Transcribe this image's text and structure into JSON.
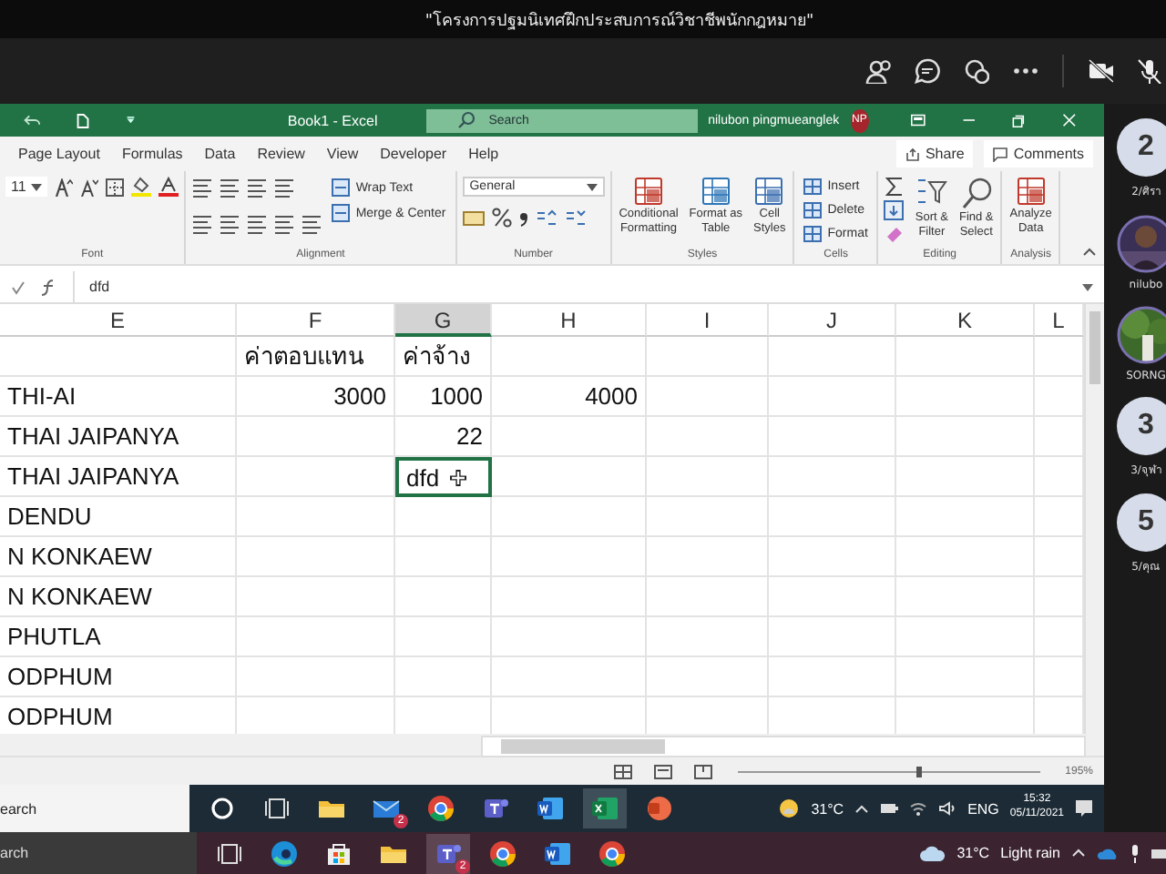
{
  "meeting": {
    "title": "\"โครงการปฐมนิเทศฝึกประสบการณ์วิชาชีพนักกฎหมาย\"",
    "toolbar": [
      {
        "kind": "people"
      },
      {
        "kind": "chat"
      },
      {
        "kind": "reactions"
      },
      {
        "kind": "more"
      },
      {
        "kind": "camera-off"
      },
      {
        "kind": "mic-off"
      }
    ]
  },
  "excel": {
    "title": "Book1 - Excel",
    "search": {
      "placeholder": "Search"
    },
    "user": "nilubon pingmueanglek",
    "avatar": "NP",
    "tabs": [
      "Page Layout",
      "Formulas",
      "Data",
      "Review",
      "View",
      "Developer",
      "Help"
    ],
    "share": "Share",
    "comments": "Comments",
    "ribbon_groups": [
      {
        "name": "Font",
        "kind": "font",
        "items": [
          "11"
        ]
      },
      {
        "name": "Alignment",
        "kind": "alignment",
        "items": [
          "Wrap Text",
          "Merge & Center"
        ]
      },
      {
        "name": "Number",
        "kind": "number",
        "items": [
          "General"
        ]
      },
      {
        "name": "Styles",
        "kind": "large",
        "items": [
          "Conditional\nFormatting",
          "Format as\nTable",
          "Cell\nStyles"
        ]
      },
      {
        "name": "Cells",
        "kind": "small",
        "items": [
          "Insert",
          "Delete",
          "Format"
        ]
      },
      {
        "name": "Editing",
        "kind": "editing",
        "items": [
          "Sort &\nFilter",
          "Find &\nSelect"
        ]
      },
      {
        "name": "Analysis",
        "kind": "large",
        "items": [
          "Analyze\nData"
        ]
      }
    ],
    "formula": "dfd",
    "columns": [
      {
        "label": "E",
        "selected": false
      },
      {
        "label": "F",
        "selected": false
      },
      {
        "label": "G",
        "selected": true
      },
      {
        "label": "H",
        "selected": false
      },
      {
        "label": "I",
        "selected": false
      },
      {
        "label": "J",
        "selected": false
      },
      {
        "label": "K",
        "selected": false
      },
      {
        "label": "L",
        "selected": false
      }
    ],
    "rows": [
      {
        "cells": [
          {
            "kind": "empty",
            "selected": false
          },
          {
            "text": "ค่าตอบแทน",
            "kind": "text",
            "selected": false
          },
          {
            "text": "ค่าจ้าง",
            "kind": "text",
            "selected": false
          }
        ]
      },
      {
        "cells": [
          {
            "text": "THI-AI",
            "kind": "text",
            "selected": false
          },
          {
            "text": "3000",
            "kind": "number",
            "selected": false
          },
          {
            "text": "1000",
            "kind": "number",
            "selected": false
          },
          {
            "text": "4000",
            "kind": "number",
            "selected": false
          }
        ]
      },
      {
        "cells": [
          {
            "text": "THAI  JAIPANYA",
            "kind": "text",
            "selected": false
          },
          {
            "kind": "empty",
            "selected": false
          },
          {
            "text": "22",
            "kind": "number",
            "selected": false
          }
        ]
      },
      {
        "cells": [
          {
            "text": "THAI  JAIPANYA",
            "kind": "text",
            "selected": false
          },
          {
            "kind": "empty",
            "selected": false
          },
          {
            "text": "dfd",
            "kind": "text",
            "selected": true
          }
        ]
      },
      {
        "cells": [
          {
            "text": "DENDU",
            "kind": "text",
            "selected": false
          }
        ]
      },
      {
        "cells": [
          {
            "text": "N  KONKAEW",
            "kind": "text",
            "selected": false
          }
        ]
      },
      {
        "cells": [
          {
            "text": "N  KONKAEW",
            "kind": "text",
            "selected": false
          }
        ]
      },
      {
        "cells": [
          {
            "text": "PHUTLA",
            "kind": "text",
            "selected": false
          }
        ]
      },
      {
        "cells": [
          {
            "text": "ODPHUM",
            "kind": "text",
            "selected": false
          }
        ]
      },
      {
        "cells": [
          {
            "text": "ODPHUM",
            "kind": "text",
            "selected": false
          }
        ]
      }
    ],
    "zoom": "195%",
    "taskbar": {
      "search": "earch",
      "apps": [
        {
          "kind": "cortana",
          "selected": false
        },
        {
          "kind": "taskview",
          "selected": false
        },
        {
          "kind": "folder",
          "selected": false
        },
        {
          "kind": "mail",
          "selected": false,
          "badge": "2"
        },
        {
          "kind": "chrome",
          "selected": false
        },
        {
          "kind": "teams",
          "selected": false
        },
        {
          "kind": "word",
          "selected": false
        },
        {
          "kind": "excel",
          "selected": true
        },
        {
          "kind": "powerpoint",
          "selected": false
        }
      ],
      "temperature": "31°C",
      "language": "ENG",
      "time": "15:32",
      "date": "05/11/2021"
    }
  },
  "taskbar": {
    "search": "arch",
    "apps": [
      {
        "kind": "taskview",
        "selected": false
      },
      {
        "kind": "edge",
        "selected": false
      },
      {
        "kind": "store",
        "selected": false
      },
      {
        "kind": "folder",
        "selected": false
      },
      {
        "kind": "teams",
        "selected": true,
        "badge": "2"
      },
      {
        "kind": "chrome",
        "selected": false
      },
      {
        "kind": "word",
        "selected": false
      },
      {
        "kind": "chrome",
        "selected": false
      }
    ],
    "temperature": "31°C",
    "weather": "Light rain"
  },
  "participants": [
    {
      "kind": "initial",
      "initial": "2",
      "name": "2/ศิรา"
    },
    {
      "name": "nilubo"
    },
    {
      "name": "SORNG"
    },
    {
      "kind": "initial",
      "initial": "3",
      "name": "3/จุฬา"
    },
    {
      "kind": "initial",
      "initial": "5",
      "name": "5/คุณ"
    }
  ]
}
